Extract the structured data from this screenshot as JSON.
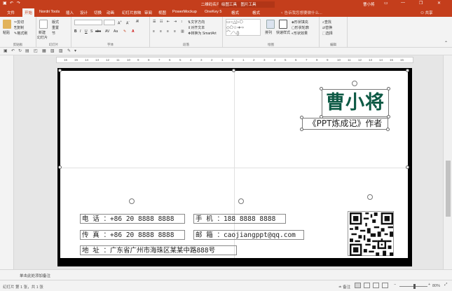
{
  "titlebar": {
    "title": "二维码名片模版 - PowerPoint",
    "context_tab_group": "绘图工具",
    "context_tab_group2": "图片工具",
    "user": "曹小将",
    "min": "—",
    "restore": "❐",
    "close": "✕"
  },
  "tabs": {
    "items": [
      "文件",
      "开始",
      "Nordri Tools",
      "插入",
      "设计",
      "切换",
      "动画",
      "幻灯片放映",
      "审阅",
      "视图",
      "PowerMockup",
      "OneKey 5",
      "格式",
      "格式"
    ],
    "tell_me": "告诉我您想要做什么...",
    "share": "共享"
  },
  "ribbon": {
    "clipboard": {
      "name": "剪贴板",
      "paste": "粘贴",
      "cut": "剪切",
      "copy": "复制",
      "format_painter": "格式刷"
    },
    "slides": {
      "name": "幻灯片",
      "new": "新建",
      "new2": "幻灯片",
      "layout": "版式",
      "reset": "重置",
      "section": "节"
    },
    "font": {
      "name": "字体"
    },
    "paragraph": {
      "name": "段落",
      "text_direction": "文字方向",
      "align_text": "对齐文本",
      "smartart": "转换为 SmartArt"
    },
    "drawing": {
      "name": "绘图",
      "arrange": "排列",
      "quick_styles": "快速样式",
      "shape_fill": "形状填充",
      "shape_outline": "形状轮廓",
      "shape_effects": "形状效果"
    },
    "editing": {
      "name": "编辑",
      "find": "查找",
      "replace": "替换",
      "select": "选择"
    }
  },
  "ruler": {
    "ticks": [
      "16",
      "15",
      "14",
      "13",
      "12",
      "11",
      "10",
      "9",
      "8",
      "7",
      "6",
      "5",
      "4",
      "3",
      "2",
      "1",
      "0",
      "1",
      "2",
      "3",
      "4",
      "5",
      "6",
      "7",
      "8",
      "9",
      "10",
      "11",
      "12",
      "13",
      "14",
      "15",
      "16"
    ]
  },
  "slide": {
    "name": "曹小将",
    "subtitle": "《PPT炼成记》作者",
    "contact": {
      "line1a": "电   话 ：+86 20 8888 8888",
      "line1b": "手   机 ：188 8888 8888",
      "line2a": "传   真 ：+86 20 8888 8888",
      "line2b": "邮   箱 ：caojiangppt@qq.com",
      "line3": "地   址 ：广东省广州市海珠区某某中路888号"
    }
  },
  "notes": {
    "placeholder": "单击此处添加备注"
  },
  "status": {
    "slide_count": "幻灯片 第 1 张，共 1 张",
    "notes_label": "备注",
    "zoom": "80%"
  },
  "colors": {
    "accent": "#c43e1c",
    "name_color": "#0e5a45"
  }
}
